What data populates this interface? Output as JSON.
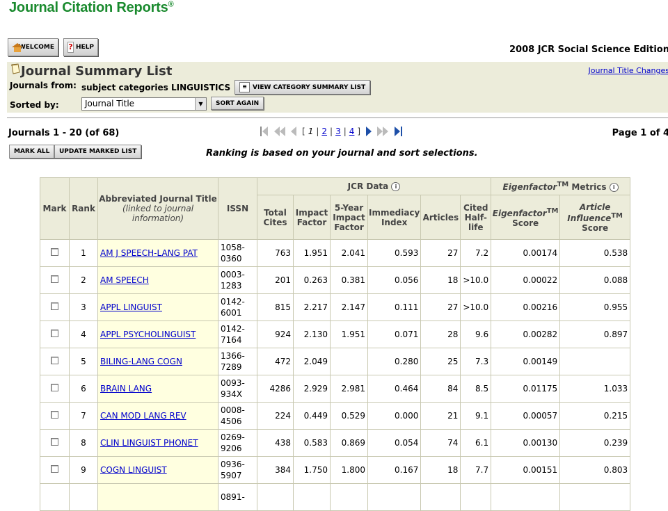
{
  "brand": {
    "name": "Journal Citation Reports",
    "mark": "®"
  },
  "toolbar": {
    "welcome_label": "WELCOME",
    "help_label": "HELP"
  },
  "edition": "2008 JCR Social Science Edition",
  "summary": {
    "title": "Journal Summary List",
    "title_changes_link": "Journal Title Changes",
    "journals_from_label": "Journals from:",
    "journals_from_value": "subject categories LINGUISTICS",
    "view_category_button": "VIEW CATEGORY SUMMARY LIST",
    "sorted_by_label": "Sorted by:",
    "sort_select_value": "Journal Title",
    "sort_again_button": "SORT AGAIN"
  },
  "listing": {
    "count_text": "Journals 1 - 20 (of 68)",
    "pages": [
      "1",
      "2",
      "3",
      "4"
    ],
    "current_page": "1",
    "page_of_text": "Page 1 of 4",
    "mark_all_button": "MARK ALL",
    "update_marked_button": "UPDATE MARKED LIST",
    "ranking_note": "Ranking is based on your journal and sort selections."
  },
  "table": {
    "headers": {
      "mark": "Mark",
      "rank": "Rank",
      "title": "Abbreviated Journal Title",
      "title_sub": "(linked to journal information)",
      "issn": "ISSN",
      "jcr_group": "JCR Data",
      "eigen_group_a": "Eigenfactor",
      "eigen_group_tm": "TM",
      "eigen_group_b": " Metrics",
      "total_cites": "Total Cites",
      "impact_factor": "Impact Factor",
      "five_year": "5-Year Impact Factor",
      "immediacy": "Immediacy Index",
      "articles": "Articles",
      "half_life": "Cited Half-life",
      "eigen_score_a": "Eigenfactor",
      "eigen_score_tm": "TM",
      "eigen_score_b": "Score",
      "influence_a": "Article Influence",
      "influence_tm": "TM",
      "influence_b": "Score"
    },
    "rows": [
      {
        "rank": "1",
        "title": "AM J SPEECH-LANG PAT",
        "issn1": "1058-",
        "issn2": "0360",
        "cites": "763",
        "impact": "1.951",
        "five": "2.041",
        "immediacy": "0.593",
        "articles": "27",
        "half": "7.2",
        "eigen": "0.00174",
        "influence": "0.538"
      },
      {
        "rank": "2",
        "title": "AM SPEECH",
        "issn1": "0003-",
        "issn2": "1283",
        "cites": "201",
        "impact": "0.263",
        "five": "0.381",
        "immediacy": "0.056",
        "articles": "18",
        "half": ">10.0",
        "eigen": "0.00022",
        "influence": "0.088"
      },
      {
        "rank": "3",
        "title": "APPL LINGUIST",
        "issn1": "0142-",
        "issn2": "6001",
        "cites": "815",
        "impact": "2.217",
        "five": "2.147",
        "immediacy": "0.111",
        "articles": "27",
        "half": ">10.0",
        "eigen": "0.00216",
        "influence": "0.955"
      },
      {
        "rank": "4",
        "title": "APPL PSYCHOLINGUIST",
        "issn1": "0142-",
        "issn2": "7164",
        "cites": "924",
        "impact": "2.130",
        "five": "1.951",
        "immediacy": "0.071",
        "articles": "28",
        "half": "9.6",
        "eigen": "0.00282",
        "influence": "0.897"
      },
      {
        "rank": "5",
        "title": "BILING-LANG COGN",
        "issn1": "1366-",
        "issn2": "7289",
        "cites": "472",
        "impact": "2.049",
        "five": "",
        "immediacy": "0.280",
        "articles": "25",
        "half": "7.3",
        "eigen": "0.00149",
        "influence": ""
      },
      {
        "rank": "6",
        "title": "BRAIN LANG",
        "issn1": "0093-",
        "issn2": "934X",
        "cites": "4286",
        "impact": "2.929",
        "five": "2.981",
        "immediacy": "0.464",
        "articles": "84",
        "half": "8.5",
        "eigen": "0.01175",
        "influence": "1.033"
      },
      {
        "rank": "7",
        "title": "CAN MOD LANG REV",
        "issn1": "0008-",
        "issn2": "4506",
        "cites": "224",
        "impact": "0.449",
        "five": "0.529",
        "immediacy": "0.000",
        "articles": "21",
        "half": "9.1",
        "eigen": "0.00057",
        "influence": "0.215"
      },
      {
        "rank": "8",
        "title": "CLIN LINGUIST PHONET",
        "issn1": "0269-",
        "issn2": "9206",
        "cites": "438",
        "impact": "0.583",
        "five": "0.869",
        "immediacy": "0.054",
        "articles": "74",
        "half": "6.1",
        "eigen": "0.00130",
        "influence": "0.239"
      },
      {
        "rank": "9",
        "title": "COGN LINGUIST",
        "issn1": "0936-",
        "issn2": "5907",
        "cites": "384",
        "impact": "1.750",
        "five": "1.800",
        "immediacy": "0.167",
        "articles": "18",
        "half": "7.7",
        "eigen": "0.00151",
        "influence": "0.803"
      },
      {
        "rank": "",
        "title": "",
        "issn1": "0891-",
        "issn2": "",
        "cites": "",
        "impact": "",
        "five": "",
        "immediacy": "",
        "articles": "",
        "half": "",
        "eigen": "",
        "influence": ""
      }
    ]
  }
}
